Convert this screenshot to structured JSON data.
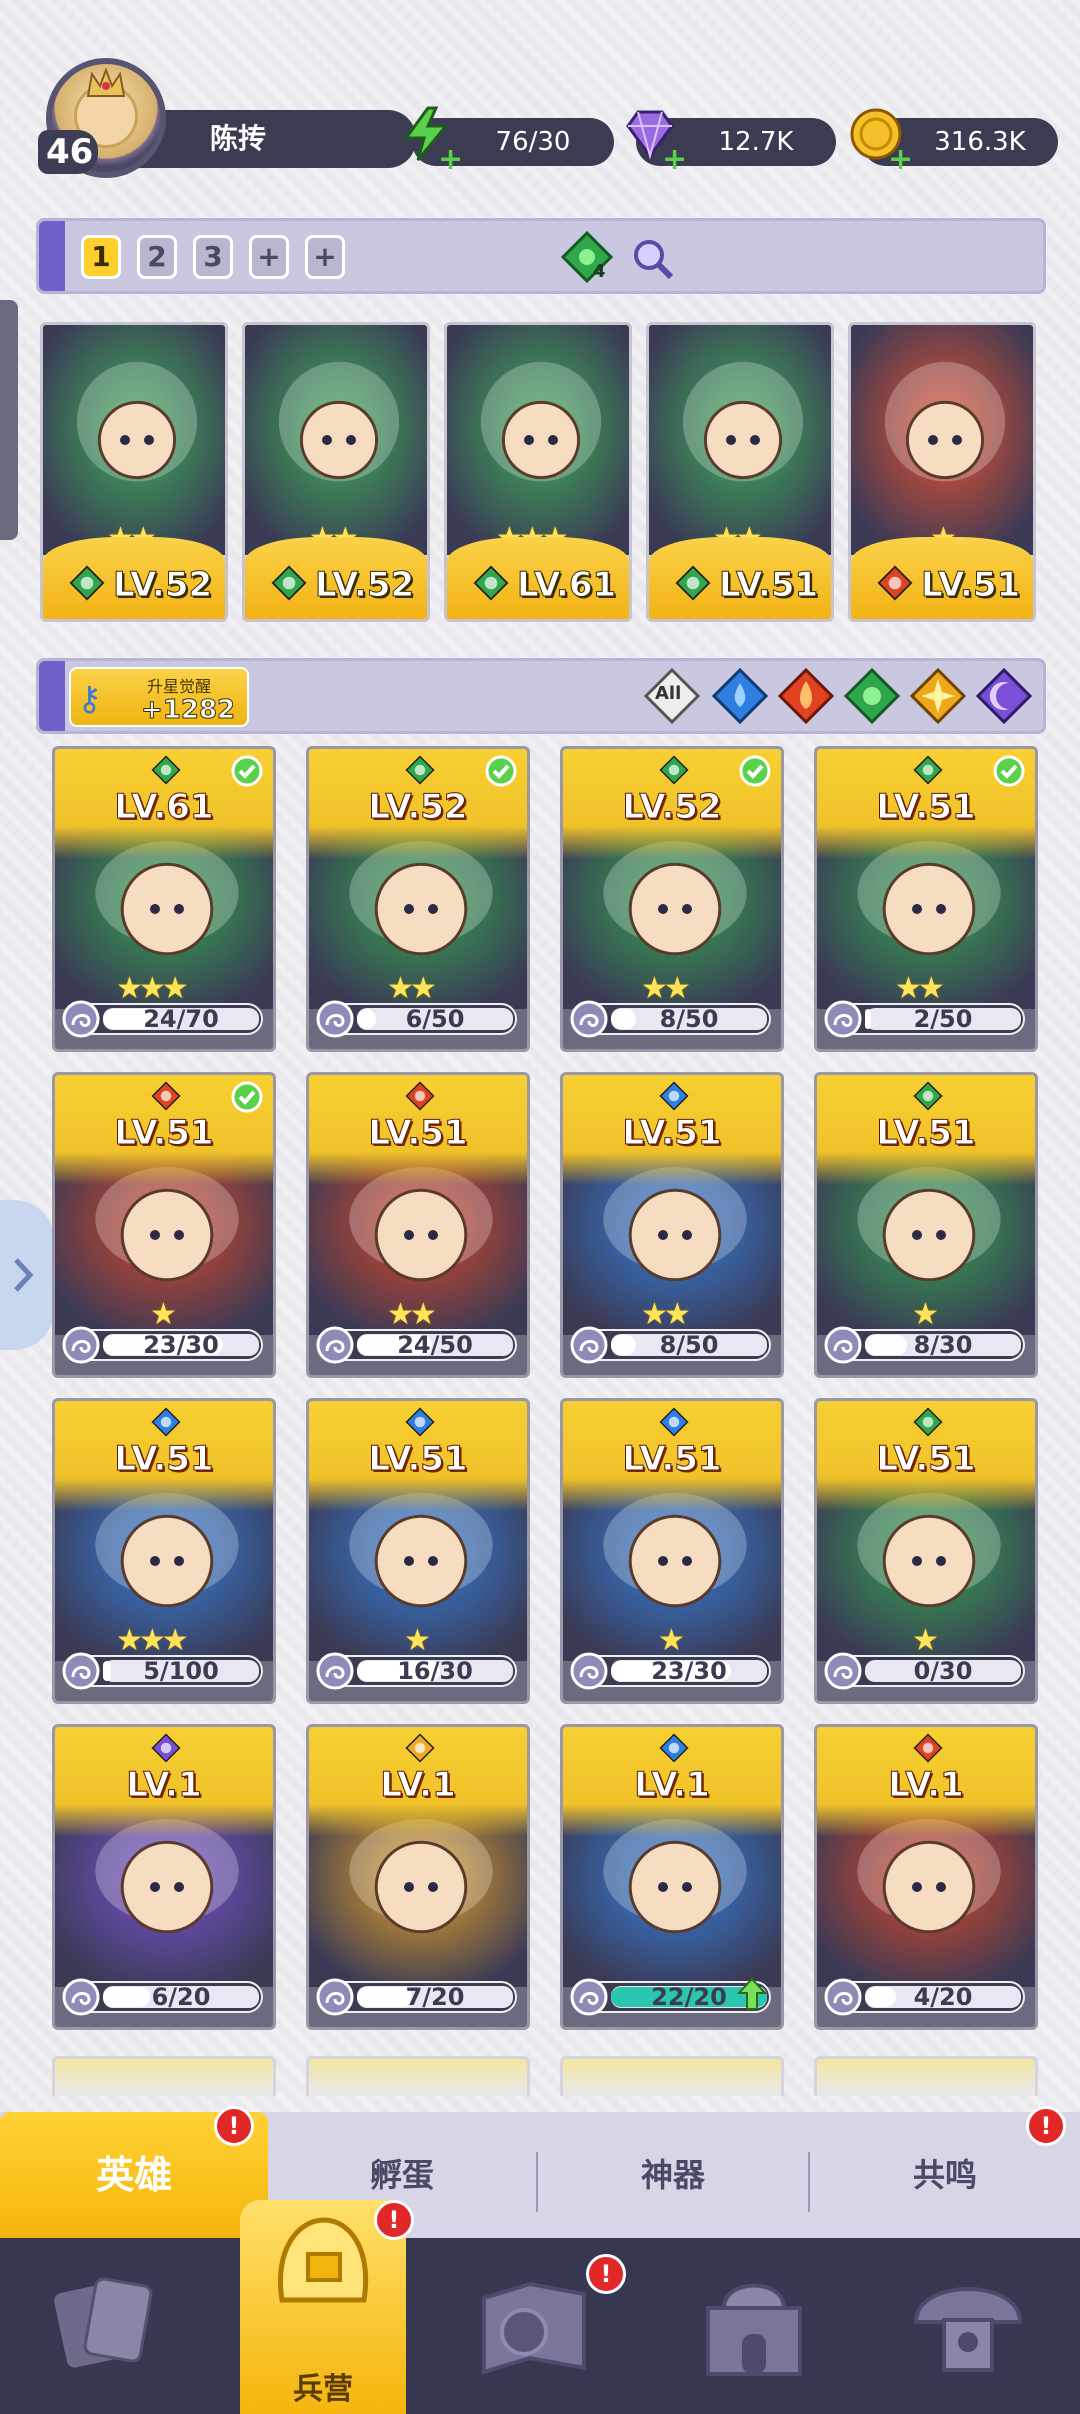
{
  "player": {
    "level": "46",
    "name": "陈抟"
  },
  "resources": [
    {
      "icon": "energy-bolt-icon",
      "value": "76/30"
    },
    {
      "icon": "gem-icon",
      "value": "12.7K"
    },
    {
      "icon": "gold-coin-icon",
      "value": "316.3K"
    }
  ],
  "team_bar": {
    "slots": [
      "1",
      "2",
      "3",
      "+",
      "+"
    ],
    "active_slot": "1",
    "gem_count": "4"
  },
  "team_heroes": [
    {
      "level": "LV.52",
      "element": "nature",
      "stars": 2
    },
    {
      "level": "LV.52",
      "element": "nature",
      "stars": 2
    },
    {
      "level": "LV.61",
      "element": "nature",
      "stars": 3
    },
    {
      "level": "LV.51",
      "element": "nature",
      "stars": 2
    },
    {
      "level": "LV.51",
      "element": "fire",
      "stars": 1
    }
  ],
  "collection_bar": {
    "awaken_title": "升星觉醒",
    "awaken_value": "+1282",
    "filters": [
      "All",
      "water",
      "fire",
      "nature",
      "light",
      "dark"
    ]
  },
  "heroes": [
    {
      "level": "LV.61",
      "element": "nature",
      "checked": true,
      "progress": "24/70",
      "frac": 0.34,
      "stars": 3
    },
    {
      "level": "LV.52",
      "element": "nature",
      "checked": true,
      "progress": "6/50",
      "frac": 0.12,
      "stars": 2
    },
    {
      "level": "LV.52",
      "element": "nature",
      "checked": true,
      "progress": "8/50",
      "frac": 0.16,
      "stars": 2
    },
    {
      "level": "LV.51",
      "element": "nature",
      "checked": true,
      "progress": "2/50",
      "frac": 0.04,
      "stars": 2
    },
    {
      "level": "LV.51",
      "element": "fire",
      "checked": true,
      "progress": "23/30",
      "frac": 0.77,
      "stars": 1
    },
    {
      "level": "LV.51",
      "element": "fire",
      "checked": false,
      "progress": "24/50",
      "frac": 0.48,
      "stars": 2
    },
    {
      "level": "LV.51",
      "element": "water",
      "checked": false,
      "progress": "8/50",
      "frac": 0.16,
      "stars": 2
    },
    {
      "level": "LV.51",
      "element": "nature",
      "checked": false,
      "progress": "8/30",
      "frac": 0.27,
      "stars": 1
    },
    {
      "level": "LV.51",
      "element": "water",
      "checked": false,
      "progress": "5/100",
      "frac": 0.05,
      "stars": 3
    },
    {
      "level": "LV.51",
      "element": "water",
      "checked": false,
      "progress": "16/30",
      "frac": 0.53,
      "stars": 1
    },
    {
      "level": "LV.51",
      "element": "water",
      "checked": false,
      "progress": "23/30",
      "frac": 0.77,
      "stars": 1
    },
    {
      "level": "LV.51",
      "element": "nature",
      "checked": false,
      "progress": "0/30",
      "frac": 0,
      "stars": 1
    },
    {
      "level": "LV.1",
      "element": "dark",
      "checked": false,
      "progress": "6/20",
      "frac": 0.3,
      "stars": 0
    },
    {
      "level": "LV.1",
      "element": "light",
      "checked": false,
      "progress": "7/20",
      "frac": 0.35,
      "stars": 0
    },
    {
      "level": "LV.1",
      "element": "water",
      "checked": false,
      "progress": "22/20",
      "frac": 1,
      "stars": 0,
      "upgrade": true
    },
    {
      "level": "LV.1",
      "element": "fire",
      "checked": false,
      "progress": "4/20",
      "frac": 0.2,
      "stars": 0
    }
  ],
  "tabs": [
    {
      "label": "英雄",
      "active": true,
      "alert": true
    },
    {
      "label": "孵蛋",
      "active": false,
      "alert": false
    },
    {
      "label": "神器",
      "active": false,
      "alert": false
    },
    {
      "label": "共鸣",
      "active": false,
      "alert": true
    }
  ],
  "nav": [
    {
      "icon": "cards-icon",
      "label": ""
    },
    {
      "icon": "barracks-helmet-icon",
      "label": "兵营",
      "active": true,
      "alert": true
    },
    {
      "icon": "map-book-icon",
      "label": "",
      "alert": true
    },
    {
      "icon": "castle-icon",
      "label": ""
    },
    {
      "icon": "mushroom-house-icon",
      "label": ""
    }
  ],
  "alert_mark": "!",
  "colors": {
    "nature": "#2fa74a",
    "fire": "#e0431f",
    "water": "#2f7fe0",
    "light": "#f0a81e",
    "dark": "#7a4fd6",
    "gold": "#f5c02a"
  }
}
